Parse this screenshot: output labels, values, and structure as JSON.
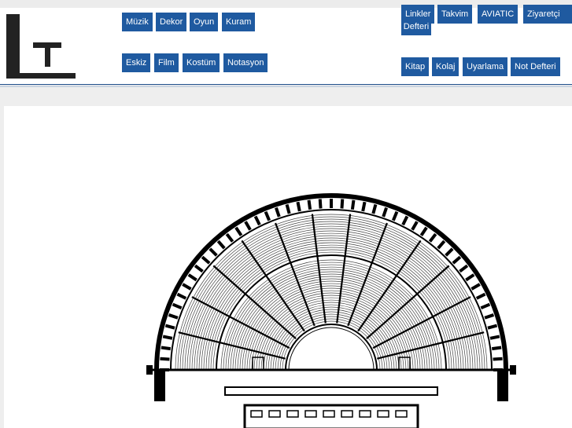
{
  "nav": {
    "row1_left": [
      "Müzik",
      "Dekor",
      "Oyun",
      "Kuram"
    ],
    "row2_left": [
      "Eskiz",
      "Film",
      "Kostüm",
      "Notasyon"
    ],
    "row1_right": [
      "Linkler",
      "Takvim",
      "AVIATIC",
      "Ziyaretçi Defteri"
    ],
    "row2_right": [
      "Kitap",
      "Kolaj",
      "Uyarlama",
      "Not Defteri"
    ]
  },
  "colors": {
    "nav_button": "#1f5aa0",
    "nav_text": "#ffffff",
    "header_rule": "#1f4f8c"
  },
  "main": {
    "image": "ancient-theater-plan-drawing"
  }
}
